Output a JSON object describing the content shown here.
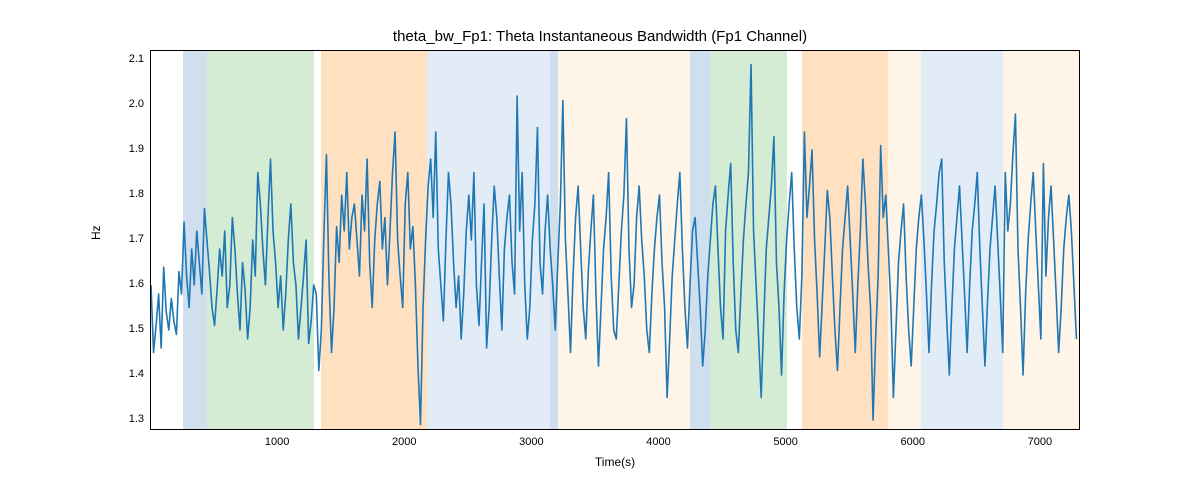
{
  "chart_data": {
    "type": "line",
    "title": "theta_bw_Fp1: Theta Instantaneous Bandwidth (Fp1 Channel)",
    "xlabel": "Time(s)",
    "ylabel": "Hz",
    "xlim": [
      0,
      7300
    ],
    "ylim": [
      1.28,
      2.12
    ],
    "xticks": [
      1000,
      2000,
      3000,
      4000,
      5000,
      6000,
      7000
    ],
    "yticks": [
      1.3,
      1.4,
      1.5,
      1.6,
      1.7,
      1.8,
      1.9,
      2.0,
      2.1
    ],
    "line_color": "#1f77b4",
    "bands": [
      {
        "start": 250,
        "end": 440,
        "color": "blue"
      },
      {
        "start": 440,
        "end": 1280,
        "color": "green"
      },
      {
        "start": 1340,
        "end": 2170,
        "color": "orange"
      },
      {
        "start": 2170,
        "end": 2420,
        "color": "lightblue"
      },
      {
        "start": 2420,
        "end": 3140,
        "color": "lightblue"
      },
      {
        "start": 3140,
        "end": 3200,
        "color": "blue"
      },
      {
        "start": 3200,
        "end": 4240,
        "color": "cream"
      },
      {
        "start": 4240,
        "end": 4400,
        "color": "blue"
      },
      {
        "start": 4400,
        "end": 5000,
        "color": "green"
      },
      {
        "start": 5120,
        "end": 5800,
        "color": "orange"
      },
      {
        "start": 5800,
        "end": 6060,
        "color": "cream"
      },
      {
        "start": 6060,
        "end": 6700,
        "color": "lightblue"
      },
      {
        "start": 6700,
        "end": 7300,
        "color": "cream"
      }
    ],
    "series": [
      {
        "name": "theta_bw_Fp1",
        "x_step": 20,
        "values": [
          1.6,
          1.45,
          1.51,
          1.58,
          1.46,
          1.64,
          1.54,
          1.5,
          1.57,
          1.52,
          1.49,
          1.63,
          1.58,
          1.74,
          1.62,
          1.55,
          1.68,
          1.6,
          1.72,
          1.65,
          1.58,
          1.77,
          1.7,
          1.63,
          1.55,
          1.51,
          1.59,
          1.68,
          1.62,
          1.72,
          1.55,
          1.6,
          1.75,
          1.68,
          1.58,
          1.5,
          1.65,
          1.59,
          1.48,
          1.55,
          1.7,
          1.62,
          1.85,
          1.78,
          1.68,
          1.6,
          1.75,
          1.88,
          1.72,
          1.65,
          1.55,
          1.62,
          1.5,
          1.58,
          1.7,
          1.78,
          1.65,
          1.6,
          1.48,
          1.55,
          1.62,
          1.7,
          1.47,
          1.52,
          1.6,
          1.58,
          1.41,
          1.5,
          1.71,
          1.89,
          1.61,
          1.45,
          1.55,
          1.73,
          1.65,
          1.8,
          1.72,
          1.85,
          1.68,
          1.75,
          1.78,
          1.7,
          1.62,
          1.8,
          1.72,
          1.88,
          1.65,
          1.55,
          1.7,
          1.78,
          1.83,
          1.68,
          1.75,
          1.6,
          1.72,
          1.85,
          1.94,
          1.7,
          1.62,
          1.55,
          1.78,
          1.85,
          1.68,
          1.73,
          1.6,
          1.42,
          1.29,
          1.55,
          1.7,
          1.82,
          1.88,
          1.75,
          1.94,
          1.68,
          1.6,
          1.52,
          1.7,
          1.85,
          1.78,
          1.65,
          1.55,
          1.62,
          1.48,
          1.58,
          1.72,
          1.8,
          1.7,
          1.85,
          1.6,
          1.51,
          1.65,
          1.78,
          1.46,
          1.55,
          1.7,
          1.82,
          1.75,
          1.62,
          1.5,
          1.68,
          1.75,
          1.8,
          1.65,
          1.58,
          2.02,
          1.72,
          1.85,
          1.6,
          1.48,
          1.55,
          1.7,
          1.78,
          1.95,
          1.65,
          1.58,
          1.72,
          1.8,
          1.68,
          1.6,
          1.5,
          1.65,
          1.78,
          2.01,
          1.7,
          1.58,
          1.45,
          1.62,
          1.75,
          1.82,
          1.68,
          1.55,
          1.48,
          1.63,
          1.72,
          1.8,
          1.58,
          1.42,
          1.55,
          1.68,
          1.75,
          1.85,
          1.62,
          1.5,
          1.48,
          1.6,
          1.72,
          1.8,
          1.97,
          1.68,
          1.55,
          1.6,
          1.75,
          1.82,
          1.7,
          1.62,
          1.5,
          1.45,
          1.58,
          1.68,
          1.75,
          1.8,
          1.65,
          1.55,
          1.35,
          1.48,
          1.62,
          1.7,
          1.78,
          1.85,
          1.68,
          1.55,
          1.46,
          1.6,
          1.72,
          1.75,
          1.65,
          1.55,
          1.42,
          1.5,
          1.62,
          1.7,
          1.78,
          1.82,
          1.68,
          1.55,
          1.48,
          1.72,
          1.8,
          1.87,
          1.65,
          1.5,
          1.45,
          1.58,
          1.7,
          1.78,
          1.85,
          2.09,
          1.72,
          1.6,
          1.48,
          1.35,
          1.52,
          1.68,
          1.75,
          1.82,
          1.93,
          1.65,
          1.55,
          1.4,
          1.58,
          1.7,
          1.78,
          1.85,
          1.68,
          1.55,
          1.48,
          1.62,
          1.94,
          1.75,
          1.82,
          1.9,
          1.7,
          1.58,
          1.44,
          1.56,
          1.68,
          1.81,
          1.75,
          1.62,
          1.5,
          1.41,
          1.55,
          1.68,
          1.75,
          1.82,
          1.7,
          1.58,
          1.45,
          1.6,
          1.72,
          1.88,
          1.78,
          1.65,
          1.55,
          1.3,
          1.48,
          1.62,
          1.91,
          1.75,
          1.8,
          1.68,
          1.56,
          1.35,
          1.5,
          1.65,
          1.72,
          1.78,
          1.62,
          1.5,
          1.42,
          1.55,
          1.68,
          1.75,
          1.8,
          1.7,
          1.58,
          1.45,
          1.6,
          1.72,
          1.78,
          1.85,
          1.88,
          1.65,
          1.52,
          1.4,
          1.55,
          1.68,
          1.75,
          1.82,
          1.7,
          1.58,
          1.45,
          1.6,
          1.72,
          1.78,
          1.85,
          1.68,
          1.55,
          1.42,
          1.56,
          1.68,
          1.75,
          1.82,
          1.7,
          1.58,
          1.45,
          1.85,
          1.72,
          1.78,
          1.89,
          1.98,
          1.68,
          1.55,
          1.4,
          1.58,
          1.7,
          1.78,
          1.85,
          1.72,
          1.6,
          1.48,
          1.87,
          1.62,
          1.75,
          1.82,
          1.7,
          1.58,
          1.45,
          1.55,
          1.68,
          1.75,
          1.8,
          1.72,
          1.6,
          1.48
        ]
      }
    ]
  }
}
